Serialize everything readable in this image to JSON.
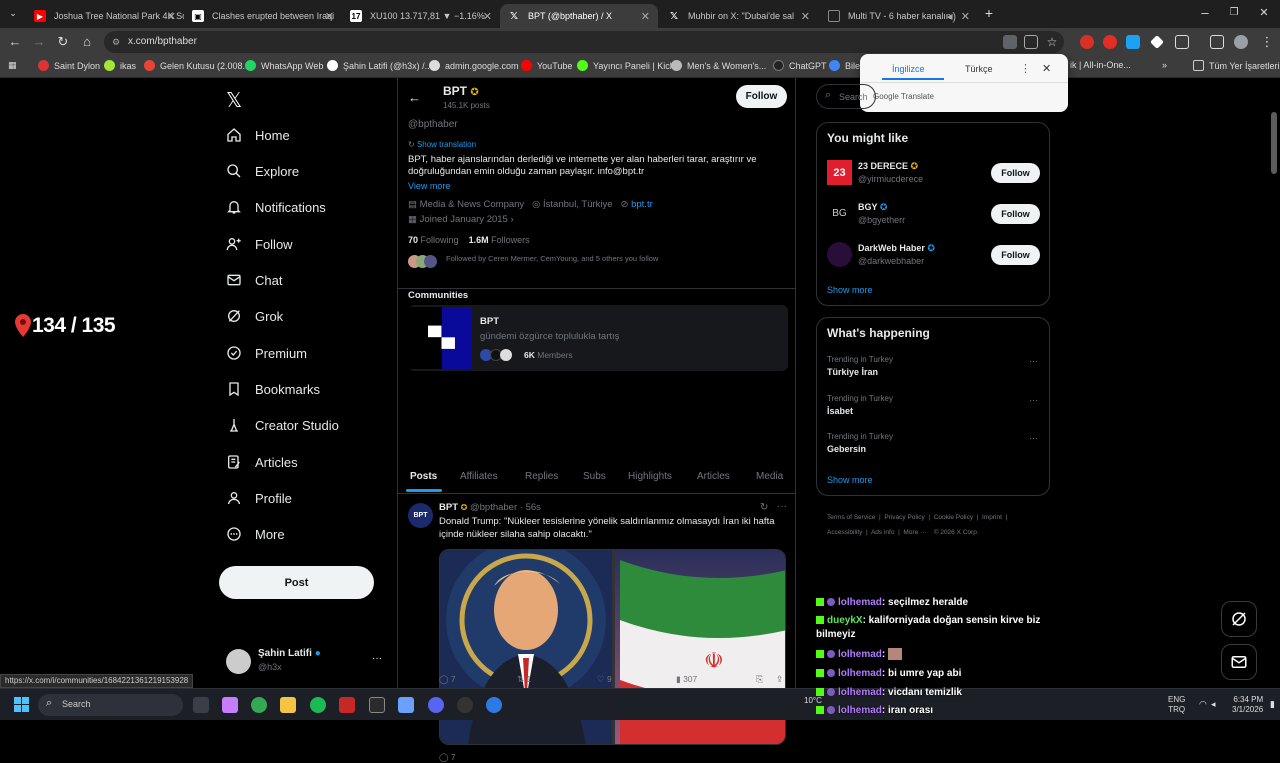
{
  "browser": {
    "tabs": [
      {
        "title": "Joshua Tree National Park 4K Sc",
        "icon": "youtube-icon",
        "color": "#ff0000"
      },
      {
        "title": "Clashes erupted between Iraqi",
        "icon": "news-icon",
        "color": "#ffffff"
      },
      {
        "title": "XU100 13.717,81 ▼ −1.16%",
        "icon": "tradingview-icon",
        "color": "#ffffff"
      },
      {
        "title": "BPT (@bpthaber) / X",
        "icon": "x-icon",
        "color": "#ffffff",
        "active": true
      },
      {
        "title": "Muhbir on X: \"Dubai'de sal",
        "icon": "x-icon",
        "color": "#ffffff"
      },
      {
        "title": "Multi TV - 6 haber kanalını",
        "icon": "tv-icon",
        "color": "#888888"
      }
    ],
    "url": "x.com/bpthaber",
    "bookmarks": [
      "Saint Dylon",
      "ikas",
      "Gelen Kutusu (2.008...",
      "WhatsApp Web",
      "Şahin Latifi (@h3x) /...",
      "admin.google.com",
      "YouTube",
      "Yayıncı Paneli | Kick",
      "Men's & Women's...",
      "ChatGPT",
      "Bileş",
      "ik | All-in-One...",
      "»",
      "Tüm Yer İşaretleri"
    ],
    "status_url": "https://x.com/i/communities/1684221361219153928"
  },
  "translate_popup": {
    "tab_source": "İngilizce",
    "tab_target": "Türkçe",
    "brand": "Google Translate"
  },
  "overlay_counter": "134 / 135",
  "nav": {
    "items": [
      {
        "label": "Home",
        "icon": "home-icon"
      },
      {
        "label": "Explore",
        "icon": "search-icon"
      },
      {
        "label": "Notifications",
        "icon": "bell-icon"
      },
      {
        "label": "Follow",
        "icon": "add-person-icon"
      },
      {
        "label": "Chat",
        "icon": "mail-icon"
      },
      {
        "label": "Grok",
        "icon": "grok-icon"
      },
      {
        "label": "Premium",
        "icon": "verified-icon"
      },
      {
        "label": "Bookmarks",
        "icon": "bookmark-icon"
      },
      {
        "label": "Creator Studio",
        "icon": "creator-icon"
      },
      {
        "label": "Articles",
        "icon": "articles-icon"
      },
      {
        "label": "Profile",
        "icon": "person-icon"
      },
      {
        "label": "More",
        "icon": "more-circle-icon"
      }
    ],
    "post_label": "Post",
    "account": {
      "name": "Şahin Latifi",
      "handle": "@h3x"
    }
  },
  "profile": {
    "name": "BPT",
    "posts_count": "145.1K posts",
    "follow_label": "Follow",
    "handle": "@bpthaber",
    "show_translation": "Show translation",
    "bio": "BPT, haber ajanslarından derlediği ve internette yer alan haberleri tarar, araştırır ve doğruluğundan emin olduğu zaman paylaşır. info@bpt.tr",
    "view_more": "View more",
    "category": "Media & News Company",
    "location": "İstanbul, Türkiye",
    "website": "bpt.tr",
    "joined": "Joined January 2015",
    "following_count": "70",
    "following_label": "Following",
    "followers_count": "1.6M",
    "followers_label": "Followers",
    "followed_by": "Followed by Ceren Mermer, CemYoung, and 5 others you follow"
  },
  "communities": {
    "heading": "Communities",
    "name": "BPT",
    "description": "gündemi özgürce toplulukla tartış",
    "members_count": "6K",
    "members_label": "Members"
  },
  "tabs": [
    "Posts",
    "Affiliates",
    "Replies",
    "Subs",
    "Highlights",
    "Articles",
    "Media"
  ],
  "tweet": {
    "name": "BPT",
    "handle": "@bpthaber",
    "time": "56s",
    "text": "Donald Trump: \"Nükleer tesislerine yönelik saldırılanmız olmasaydı İran iki hafta içinde nükleer silaha sahip olacaktı.\"",
    "replies": "7",
    "reposts": "1",
    "likes": "9",
    "views": "307"
  },
  "search_placeholder": "Search",
  "you_might_like": {
    "heading": "You might like",
    "accounts": [
      {
        "name": "23 DERECE",
        "handle": "@yirmiucderece",
        "badge": "gold"
      },
      {
        "name": "BGY",
        "handle": "@bgyetherr",
        "badge": "blue"
      },
      {
        "name": "DarkWeb Haber",
        "handle": "@darkwebhaber",
        "badge": "blue"
      }
    ],
    "follow_label": "Follow",
    "show_more": "Show more"
  },
  "whats_happening": {
    "heading": "What's happening",
    "trends": [
      {
        "context": "Trending in Turkey",
        "name": "Türkiye İran"
      },
      {
        "context": "Trending in Turkey",
        "name": "İsabet"
      },
      {
        "context": "Trending in Turkey",
        "name": "Gebersin"
      }
    ],
    "show_more": "Show more"
  },
  "footer_links": [
    "Terms of Service",
    "Privacy Policy",
    "Cookie Policy",
    "Imprint",
    "Accessibility",
    "Ads info",
    "More ···",
    "© 2026 X Corp."
  ],
  "chat": [
    {
      "user": "lolhemad",
      "msg": ": seçilmez heralde"
    },
    {
      "user": "dueykX",
      "msg": ": kaliforniyada doğan sensin kirve biz bilmeyiz"
    },
    {
      "user": "lolhemad",
      "msg": ":"
    },
    {
      "user": "lolhemad",
      "msg": ": bi umre yap abi"
    },
    {
      "user": "lolhemad",
      "msg": ": vicdanı temizlik"
    },
    {
      "user": "lolhemad",
      "msg": ": iran orası"
    }
  ],
  "taskbar": {
    "search_placeholder": "Search",
    "weather": "10°C",
    "lang_top": "ENG",
    "lang_bottom": "TRQ",
    "time": "6:34 PM",
    "date": "3/1/2026"
  }
}
